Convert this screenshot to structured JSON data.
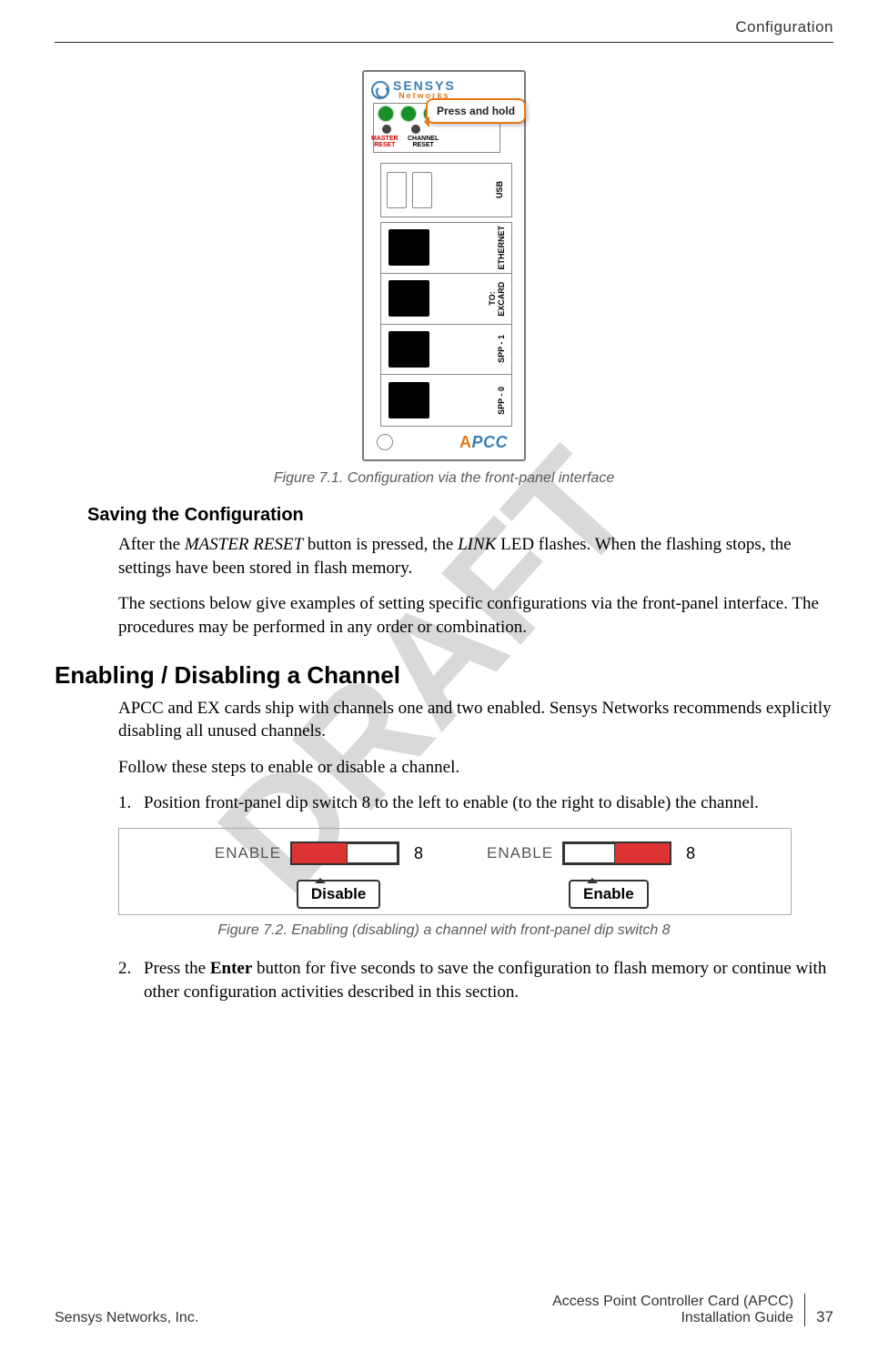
{
  "header": {
    "section": "Configuration"
  },
  "figure1": {
    "logo": {
      "line1": "SENSYS",
      "line2": "Networks"
    },
    "callout": "Press and hold",
    "labels": {
      "master_reset_l1": "MASTER",
      "master_reset_l2": "RESET",
      "channel_reset_l1": "CHANNEL",
      "channel_reset_l2": "RESET",
      "usb": "USB",
      "ethernet": "ETHERNET",
      "to_excard": "TO: EXCARD",
      "spp1": "SPP - 1",
      "spp0": "SPP - 0"
    },
    "apcc": {
      "a": "A",
      "rest": "PCC"
    },
    "caption": "Figure 7.1. Configuration via the front-panel interface"
  },
  "section1": {
    "heading": "Saving the Configuration",
    "p1_a": "After the ",
    "p1_em1": "MASTER RESET",
    "p1_b": " button is pressed, the ",
    "p1_em2": "LINK",
    "p1_c": " LED flashes. When the flashing stops, the settings have been stored in flash memory.",
    "p2": "The sections below give examples of setting specific configurations via the front-panel interface. The procedures may be performed in any order or combination."
  },
  "section2": {
    "heading": "Enabling / Disabling a Channel",
    "p1": "APCC and EX cards ship with channels one and two enabled. Sensys Networks recommends explicitly disabling all unused channels.",
    "p2": "Follow these steps to enable or disable a channel.",
    "step1_num": "1.",
    "step1": "Position front-panel dip switch 8 to the left to enable (to the right to disable) the channel.",
    "step2_num": "2.",
    "step2_a": "Press the ",
    "step2_bold": "Enter",
    "step2_b": " button for five seconds to save the configuration to flash memory or continue with other configuration activities described in this section."
  },
  "figure2": {
    "enable_label": "ENABLE",
    "switch_num": "8",
    "disable_tag": "Disable",
    "enable_tag": "Enable",
    "caption": "Figure 7.2. Enabling (disabling) a channel with front-panel dip switch 8"
  },
  "footer": {
    "left": "Sensys Networks, Inc.",
    "right1": "Access Point Controller Card (APCC)",
    "right2": "Installation Guide",
    "page": "37"
  },
  "watermark": "DRAFT"
}
